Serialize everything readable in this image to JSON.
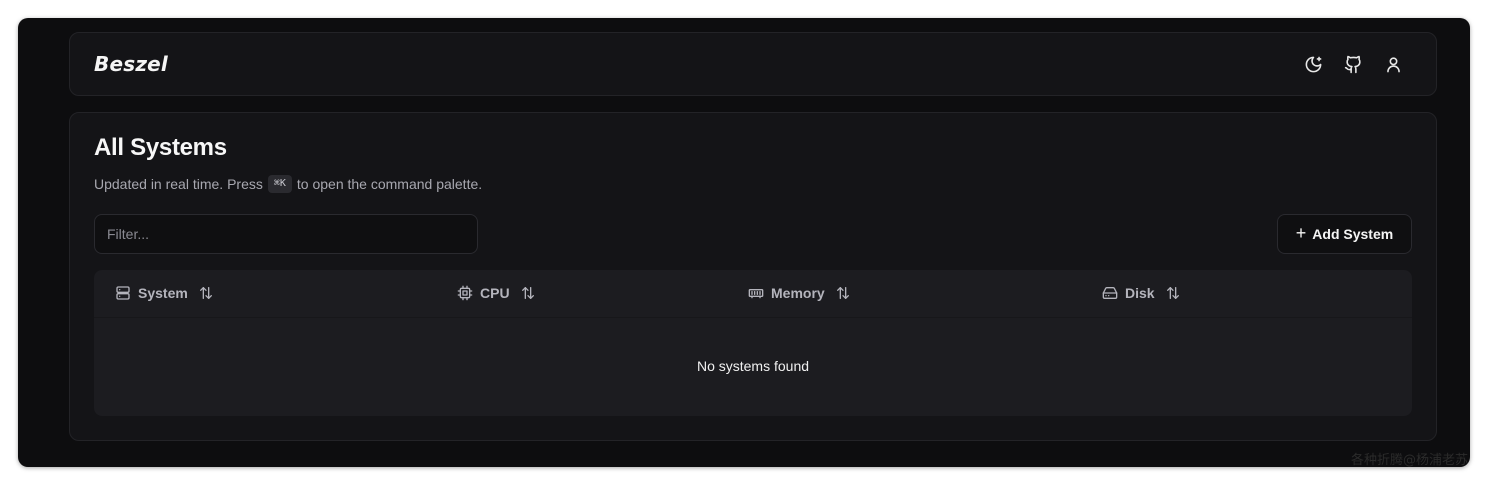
{
  "app": {
    "brand": "Beszel"
  },
  "header": {
    "icons": [
      "theme-toggle-icon",
      "github-icon",
      "user-icon"
    ]
  },
  "main": {
    "title": "All Systems",
    "subtitle_before": "Updated in real time. Press",
    "shortcut": "⌘K",
    "subtitle_after": "to open the command palette.",
    "filter": {
      "placeholder": "Filter...",
      "value": ""
    },
    "add_button_label": "Add System",
    "table": {
      "columns": [
        {
          "label": "System",
          "icon": "server-icon"
        },
        {
          "label": "CPU",
          "icon": "cpu-icon"
        },
        {
          "label": "Memory",
          "icon": "memory-icon"
        },
        {
          "label": "Disk",
          "icon": "hard-drive-icon"
        }
      ],
      "empty_message": "No systems found"
    }
  },
  "watermark": "各种折腾@杨浦老苏",
  "colors": {
    "background": "#0d0d0f",
    "card": "#141417",
    "table": "#1c1c20",
    "text": "#f5f5f5",
    "muted": "#a8a8b0"
  }
}
